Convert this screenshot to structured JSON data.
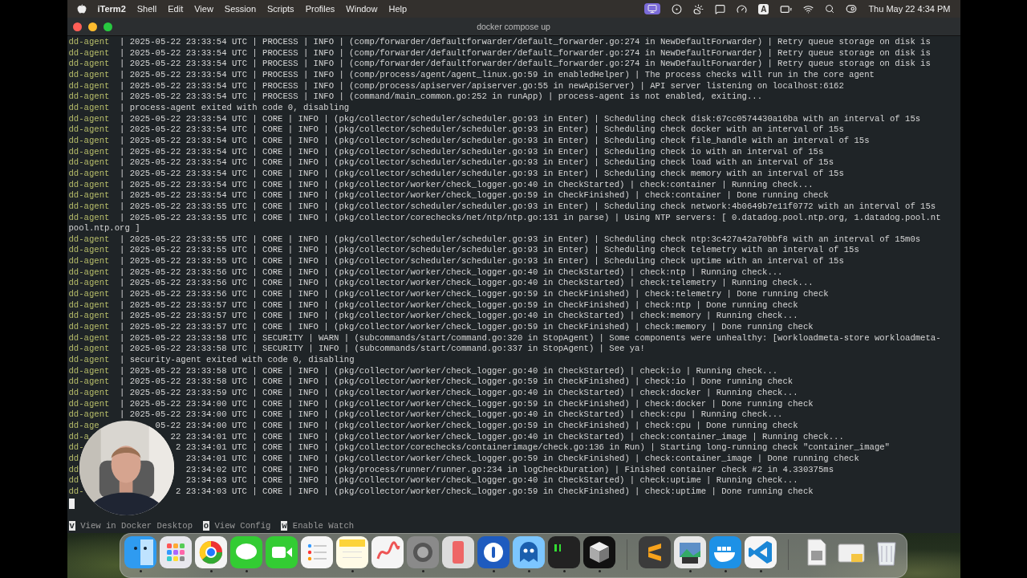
{
  "menu_bar": {
    "app": "iTerm2",
    "menus": [
      "Shell",
      "Edit",
      "View",
      "Session",
      "Scripts",
      "Profiles",
      "Window",
      "Help"
    ],
    "input_source": "A",
    "clock": "Thu May 22  4:34 PM"
  },
  "window": {
    "title": "docker compose up"
  },
  "terminal": {
    "lines": [
      {
        "agent": "dd-agent",
        "bar": "|",
        "time": "2025-05-22 23:33:54 UTC",
        "rest": "| PROCESS | INFO | (comp/forwarder/defaultforwarder/default_forwarder.go:274 in NewDefaultForwarder) | Retry queue storage on disk is"
      },
      {
        "agent": "dd-agent",
        "bar": "|",
        "time": "2025-05-22 23:33:54 UTC",
        "rest": "| PROCESS | INFO | (comp/forwarder/defaultforwarder/default_forwarder.go:274 in NewDefaultForwarder) | Retry queue storage on disk is"
      },
      {
        "agent": "dd-agent",
        "bar": "|",
        "time": "2025-05-22 23:33:54 UTC",
        "rest": "| PROCESS | INFO | (comp/forwarder/defaultforwarder/default_forwarder.go:274 in NewDefaultForwarder) | Retry queue storage on disk is"
      },
      {
        "agent": "dd-agent",
        "bar": "|",
        "time": "2025-05-22 23:33:54 UTC",
        "rest": "| PROCESS | INFO | (comp/process/agent/agent_linux.go:59 in enabledHelper) | The process checks will run in the core agent"
      },
      {
        "agent": "dd-agent",
        "bar": "|",
        "time": "2025-05-22 23:33:54 UTC",
        "rest": "| PROCESS | INFO | (comp/process/apiserver/apiserver.go:55 in newApiServer) | API server listening on localhost:6162"
      },
      {
        "agent": "dd-agent",
        "bar": "|",
        "time": "2025-05-22 23:33:54 UTC",
        "rest": "| PROCESS | INFO | (command/main_common.go:252 in runApp) | process-agent is not enabled, exiting..."
      },
      {
        "agent": "dd-agent",
        "bar": "|",
        "text": "process-agent exited with code 0, disabling"
      },
      {
        "agent": "dd-agent",
        "bar": "|",
        "time": "2025-05-22 23:33:54 UTC",
        "rest": "| CORE | INFO | (pkg/collector/scheduler/scheduler.go:93 in Enter) | Scheduling check disk:67cc0574430a16ba with an interval of 15s"
      },
      {
        "agent": "dd-agent",
        "bar": "|",
        "time": "2025-05-22 23:33:54 UTC",
        "rest": "| CORE | INFO | (pkg/collector/scheduler/scheduler.go:93 in Enter) | Scheduling check docker with an interval of 15s"
      },
      {
        "agent": "dd-agent",
        "bar": "|",
        "time": "2025-05-22 23:33:54 UTC",
        "rest": "| CORE | INFO | (pkg/collector/scheduler/scheduler.go:93 in Enter) | Scheduling check file_handle with an interval of 15s"
      },
      {
        "agent": "dd-agent",
        "bar": "|",
        "time": "2025-05-22 23:33:54 UTC",
        "rest": "| CORE | INFO | (pkg/collector/scheduler/scheduler.go:93 in Enter) | Scheduling check io with an interval of 15s"
      },
      {
        "agent": "dd-agent",
        "bar": "|",
        "time": "2025-05-22 23:33:54 UTC",
        "rest": "| CORE | INFO | (pkg/collector/scheduler/scheduler.go:93 in Enter) | Scheduling check load with an interval of 15s"
      },
      {
        "agent": "dd-agent",
        "bar": "|",
        "time": "2025-05-22 23:33:54 UTC",
        "rest": "| CORE | INFO | (pkg/collector/scheduler/scheduler.go:93 in Enter) | Scheduling check memory with an interval of 15s"
      },
      {
        "agent": "dd-agent",
        "bar": "|",
        "time": "2025-05-22 23:33:54 UTC",
        "rest": "| CORE | INFO | (pkg/collector/worker/check_logger.go:40 in CheckStarted) | check:container | Running check..."
      },
      {
        "agent": "dd-agent",
        "bar": "|",
        "time": "2025-05-22 23:33:54 UTC",
        "rest": "| CORE | INFO | (pkg/collector/worker/check_logger.go:59 in CheckFinished) | check:container | Done running check"
      },
      {
        "agent": "dd-agent",
        "bar": "|",
        "time": "2025-05-22 23:33:55 UTC",
        "rest": "| CORE | INFO | (pkg/collector/scheduler/scheduler.go:93 in Enter) | Scheduling check network:4b0649b7e11f0772 with an interval of 15s"
      },
      {
        "agent": "dd-agent",
        "bar": "|",
        "time": "2025-05-22 23:33:55 UTC",
        "rest": "| CORE | INFO | (pkg/collector/corechecks/net/ntp/ntp.go:131 in parse) | Using NTP servers: [ 0.datadog.pool.ntp.org, 1.datadog.pool.nt"
      },
      {
        "text": "pool.ntp.org ]"
      },
      {
        "agent": "dd-agent",
        "bar": "|",
        "time": "2025-05-22 23:33:55 UTC",
        "rest": "| CORE | INFO | (pkg/collector/scheduler/scheduler.go:93 in Enter) | Scheduling check ntp:3c427a42a70bbf8 with an interval of 15m0s"
      },
      {
        "agent": "dd-agent",
        "bar": "|",
        "time": "2025-05-22 23:33:55 UTC",
        "rest": "| CORE | INFO | (pkg/collector/scheduler/scheduler.go:93 in Enter) | Scheduling check telemetry with an interval of 15s"
      },
      {
        "agent": "dd-agent",
        "bar": "|",
        "time": "2025-05-22 23:33:55 UTC",
        "rest": "| CORE | INFO | (pkg/collector/scheduler/scheduler.go:93 in Enter) | Scheduling check uptime with an interval of 15s"
      },
      {
        "agent": "dd-agent",
        "bar": "|",
        "time": "2025-05-22 23:33:56 UTC",
        "rest": "| CORE | INFO | (pkg/collector/worker/check_logger.go:40 in CheckStarted) | check:ntp | Running check..."
      },
      {
        "agent": "dd-agent",
        "bar": "|",
        "time": "2025-05-22 23:33:56 UTC",
        "rest": "| CORE | INFO | (pkg/collector/worker/check_logger.go:40 in CheckStarted) | check:telemetry | Running check..."
      },
      {
        "agent": "dd-agent",
        "bar": "|",
        "time": "2025-05-22 23:33:56 UTC",
        "rest": "| CORE | INFO | (pkg/collector/worker/check_logger.go:59 in CheckFinished) | check:telemetry | Done running check"
      },
      {
        "agent": "dd-agent",
        "bar": "|",
        "time": "2025-05-22 23:33:57 UTC",
        "rest": "| CORE | INFO | (pkg/collector/worker/check_logger.go:59 in CheckFinished) | check:ntp | Done running check"
      },
      {
        "agent": "dd-agent",
        "bar": "|",
        "time": "2025-05-22 23:33:57 UTC",
        "rest": "| CORE | INFO | (pkg/collector/worker/check_logger.go:40 in CheckStarted) | check:memory | Running check..."
      },
      {
        "agent": "dd-agent",
        "bar": "|",
        "time": "2025-05-22 23:33:57 UTC",
        "rest": "| CORE | INFO | (pkg/collector/worker/check_logger.go:59 in CheckFinished) | check:memory | Done running check"
      },
      {
        "agent": "dd-agent",
        "bar": "|",
        "time": "2025-05-22 23:33:58 UTC",
        "rest": "| SECURITY | WARN | (subcommands/start/command.go:320 in StopAgent) | Some components were unhealthy: [workloadmeta-store workloadmeta-"
      },
      {
        "agent": "dd-agent",
        "bar": "|",
        "time": "2025-05-22 23:33:58 UTC",
        "rest": "| SECURITY | INFO | (subcommands/start/command.go:337 in StopAgent) | See ya!"
      },
      {
        "agent": "dd-agent",
        "bar": "|",
        "text": "security-agent exited with code 0, disabling"
      },
      {
        "agent": "dd-agent",
        "bar": "|",
        "time": "2025-05-22 23:33:58 UTC",
        "rest": "| CORE | INFO | (pkg/collector/worker/check_logger.go:40 in CheckStarted) | check:io | Running check..."
      },
      {
        "agent": "dd-agent",
        "bar": "|",
        "time": "2025-05-22 23:33:58 UTC",
        "rest": "| CORE | INFO | (pkg/collector/worker/check_logger.go:59 in CheckFinished) | check:io | Done running check"
      },
      {
        "agent": "dd-agent",
        "bar": "|",
        "time": "2025-05-22 23:33:59 UTC",
        "rest": "| CORE | INFO | (pkg/collector/worker/check_logger.go:40 in CheckStarted) | check:docker | Running check..."
      },
      {
        "agent": "dd-agent",
        "bar": "|",
        "time": "2025-05-22 23:34:00 UTC",
        "rest": "| CORE | INFO | (pkg/collector/worker/check_logger.go:59 in CheckFinished) | check:docker | Done running check"
      },
      {
        "agent": "dd-agent",
        "bar": "|",
        "time": "2025-05-22 23:34:00 UTC",
        "rest": "| CORE | INFO | (pkg/collector/worker/check_logger.go:40 in CheckStarted) | check:cpu | Running check..."
      },
      {
        "agent": "dd-age",
        "time": "05-22 23:34:00 UTC",
        "rest": "| CORE | INFO | (pkg/collector/worker/check_logger.go:59 in CheckFinished) | check:cpu | Done running check"
      },
      {
        "agent": "dd-a",
        "time": "22 23:34:01 UTC",
        "rest": "| CORE | INFO | (pkg/collector/worker/check_logger.go:40 in CheckStarted) | check:container_image | Running check..."
      },
      {
        "agent": "dd-",
        "time": "2 23:34:01 UTC",
        "rest": "| CORE | INFO | (pkg/collector/corechecks/containerimage/check.go:136 in Run) | Starting long-running check \"container_image\""
      },
      {
        "agent": "dd",
        "time": "23:34:01 UTC",
        "rest": "| CORE | INFO | (pkg/collector/worker/check_logger.go:59 in CheckFinished) | check:container_image | Done running check"
      },
      {
        "agent": "dd",
        "time": "23:34:02 UTC",
        "rest": "| CORE | INFO | (pkg/process/runner/runner.go:234 in logCheckDuration) | Finished container check #2 in 4.330375ms"
      },
      {
        "agent": "dd",
        "time": "23:34:03 UTC",
        "rest": "| CORE | INFO | (pkg/collector/worker/check_logger.go:40 in CheckStarted) | check:uptime | Running check..."
      },
      {
        "agent": "dd-",
        "time": "2 23:34:03 UTC",
        "rest": "| CORE | INFO | (pkg/collector/worker/check_logger.go:59 in CheckFinished) | check:uptime | Done running check"
      }
    ],
    "shortcuts": [
      {
        "key": "v",
        "label": "View in Docker Desktop"
      },
      {
        "key": "o",
        "label": "View Config"
      },
      {
        "key": "w",
        "label": "Enable Watch"
      }
    ]
  },
  "dock": [
    {
      "running": true
    },
    {
      "running": false
    },
    {
      "running": true
    },
    {
      "running": true
    },
    {
      "running": false
    },
    {
      "running": false
    },
    {
      "running": true
    },
    {
      "running": false
    },
    {
      "running": true
    },
    {
      "running": false
    },
    {
      "running": true
    },
    {
      "running": true
    },
    {
      "running": true
    },
    {
      "running": true
    },
    {
      "running": false
    },
    {
      "running": true
    },
    {
      "running": true
    },
    {
      "running": true
    },
    {
      "running": false
    },
    {
      "running": false
    },
    {
      "running": false
    }
  ]
}
